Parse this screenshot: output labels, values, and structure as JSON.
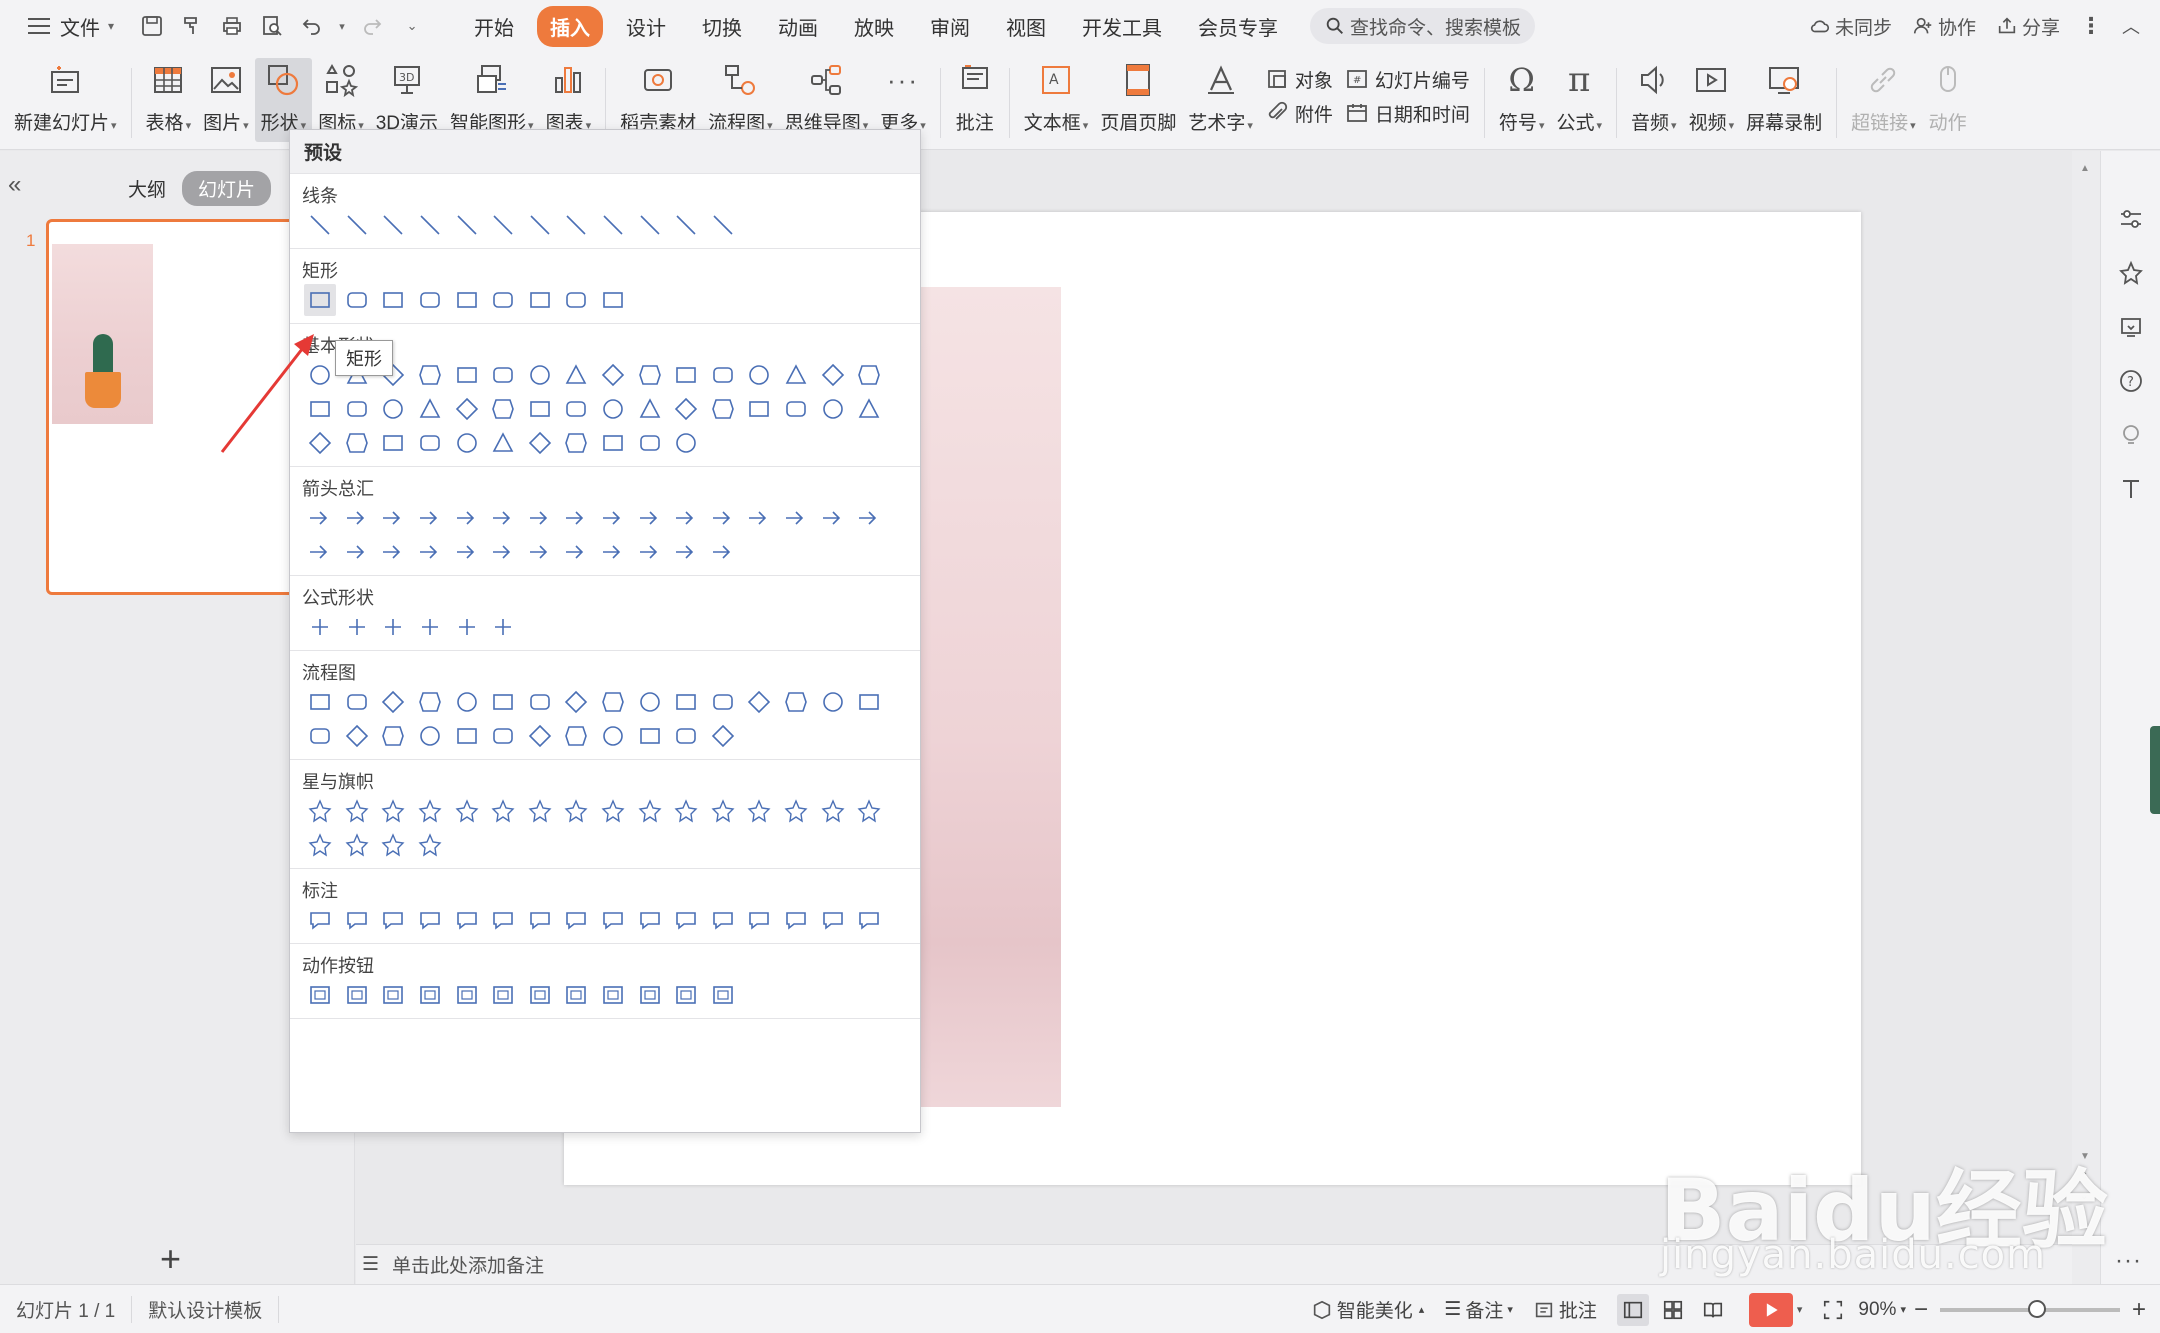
{
  "topbar": {
    "file_label": "文件",
    "tabs": [
      "开始",
      "插入",
      "设计",
      "切换",
      "动画",
      "放映",
      "审阅",
      "视图",
      "开发工具",
      "会员专享"
    ],
    "active_tab": "插入",
    "search_placeholder": "查找命令、搜索模板",
    "sync_label": "未同步",
    "collab_label": "协作",
    "share_label": "分享"
  },
  "ribbon": {
    "new_slide": "新建幻灯片",
    "table": "表格",
    "picture": "图片",
    "shape": "形状",
    "icon": "图标",
    "demo3d": "3D演示",
    "smart_shape": "智能图形",
    "chart": "图表",
    "material": "稻壳素材",
    "flowchart": "流程图",
    "mindmap": "思维导图",
    "more": "更多",
    "comment": "批注",
    "textbox": "文本框",
    "header_footer": "页眉页脚",
    "art_text": "艺术字",
    "object": "对象",
    "slide_number": "幻灯片编号",
    "attachment": "附件",
    "date_time": "日期和时间",
    "symbol": "符号",
    "formula": "公式",
    "audio": "音频",
    "video": "视频",
    "screen_record": "屏幕录制",
    "hyperlink": "超链接",
    "action": "动作"
  },
  "left_panel": {
    "outline_tab": "大纲",
    "slides_tab": "幻灯片",
    "slide_number": "1"
  },
  "shape_panel": {
    "header": "预设",
    "sections": [
      {
        "title": "线条",
        "count": 12
      },
      {
        "title": "矩形",
        "count": 9
      },
      {
        "title": "基本形状",
        "count": 43
      },
      {
        "title": "箭头总汇",
        "count": 28
      },
      {
        "title": "公式形状",
        "count": 6
      },
      {
        "title": "流程图",
        "count": 28
      },
      {
        "title": "星与旗帜",
        "count": 20
      },
      {
        "title": "标注",
        "count": 16
      },
      {
        "title": "动作按钮",
        "count": 12
      }
    ],
    "tooltip": "矩形"
  },
  "notes": {
    "placeholder": "单击此处添加备注"
  },
  "statusbar": {
    "slide_info": "幻灯片 1 / 1",
    "template": "默认设计模板",
    "beautify": "智能美化",
    "notes": "备注",
    "comments": "批注",
    "zoom": "90%"
  },
  "watermark": {
    "brand": "Baidu经验",
    "url": "jingyan.baidu.com"
  },
  "colors": {
    "accent": "#ee7a3d",
    "shape_stroke": "#4a6fb5",
    "annotation": "#e53935"
  }
}
